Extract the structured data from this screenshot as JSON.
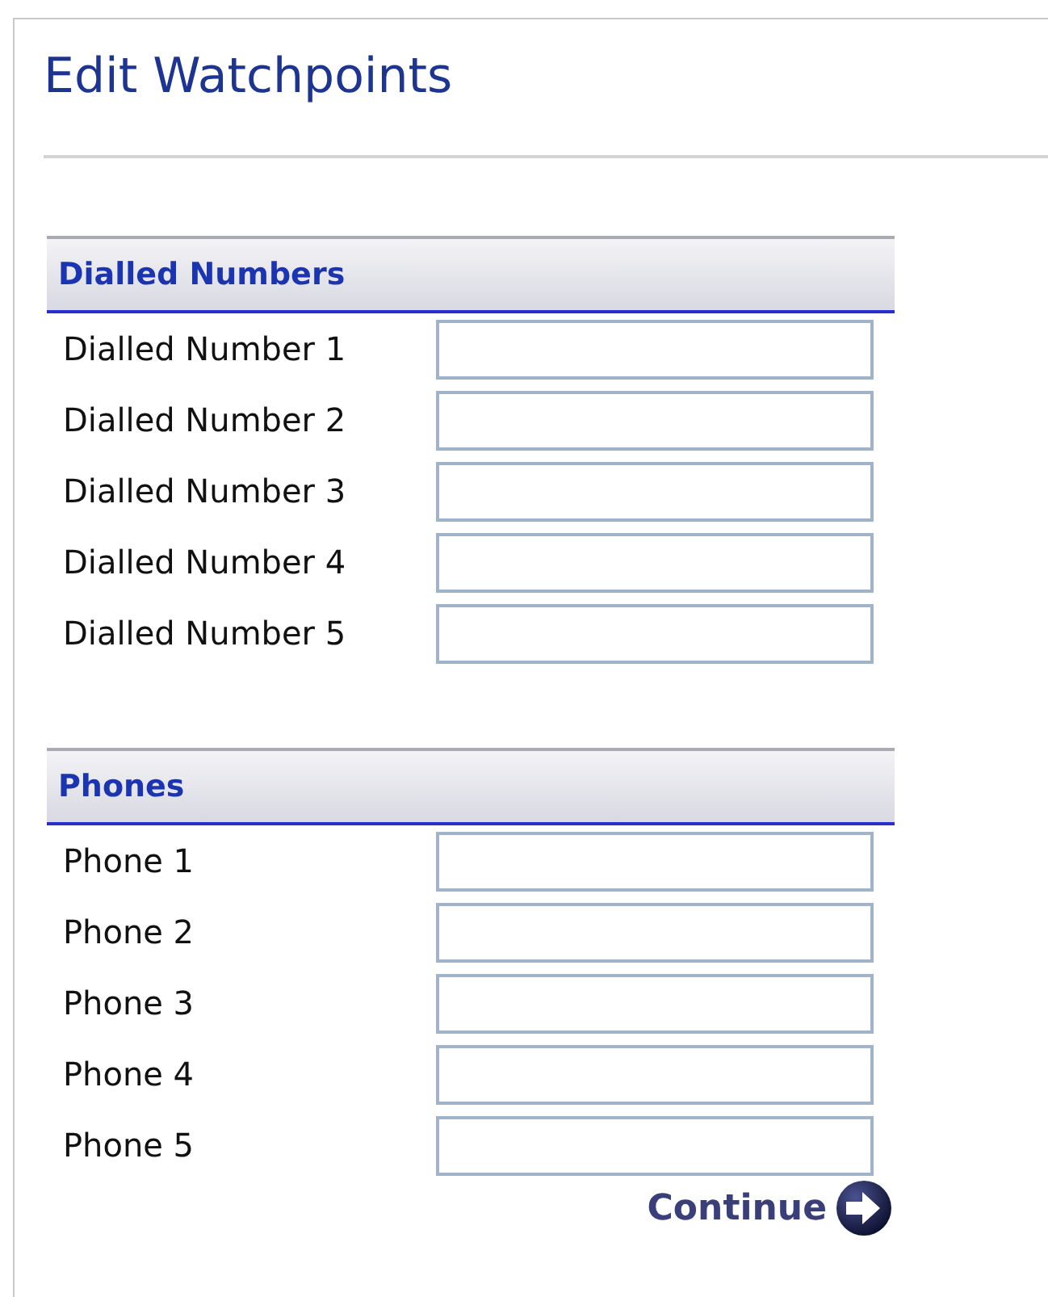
{
  "title": "Edit Watchpoints",
  "sections": [
    {
      "heading": "Dialled Numbers",
      "fields": [
        {
          "label": "Dialled Number 1"
        },
        {
          "label": "Dialled Number 2"
        },
        {
          "label": "Dialled Number 3"
        },
        {
          "label": "Dialled Number 4"
        },
        {
          "label": "Dialled Number 5"
        }
      ]
    },
    {
      "heading": "Phones",
      "fields": [
        {
          "label": "Phone 1"
        },
        {
          "label": "Phone 2"
        },
        {
          "label": "Phone 3"
        },
        {
          "label": "Phone 4"
        },
        {
          "label": "Phone 5"
        }
      ]
    }
  ],
  "continue_button": "Continue"
}
